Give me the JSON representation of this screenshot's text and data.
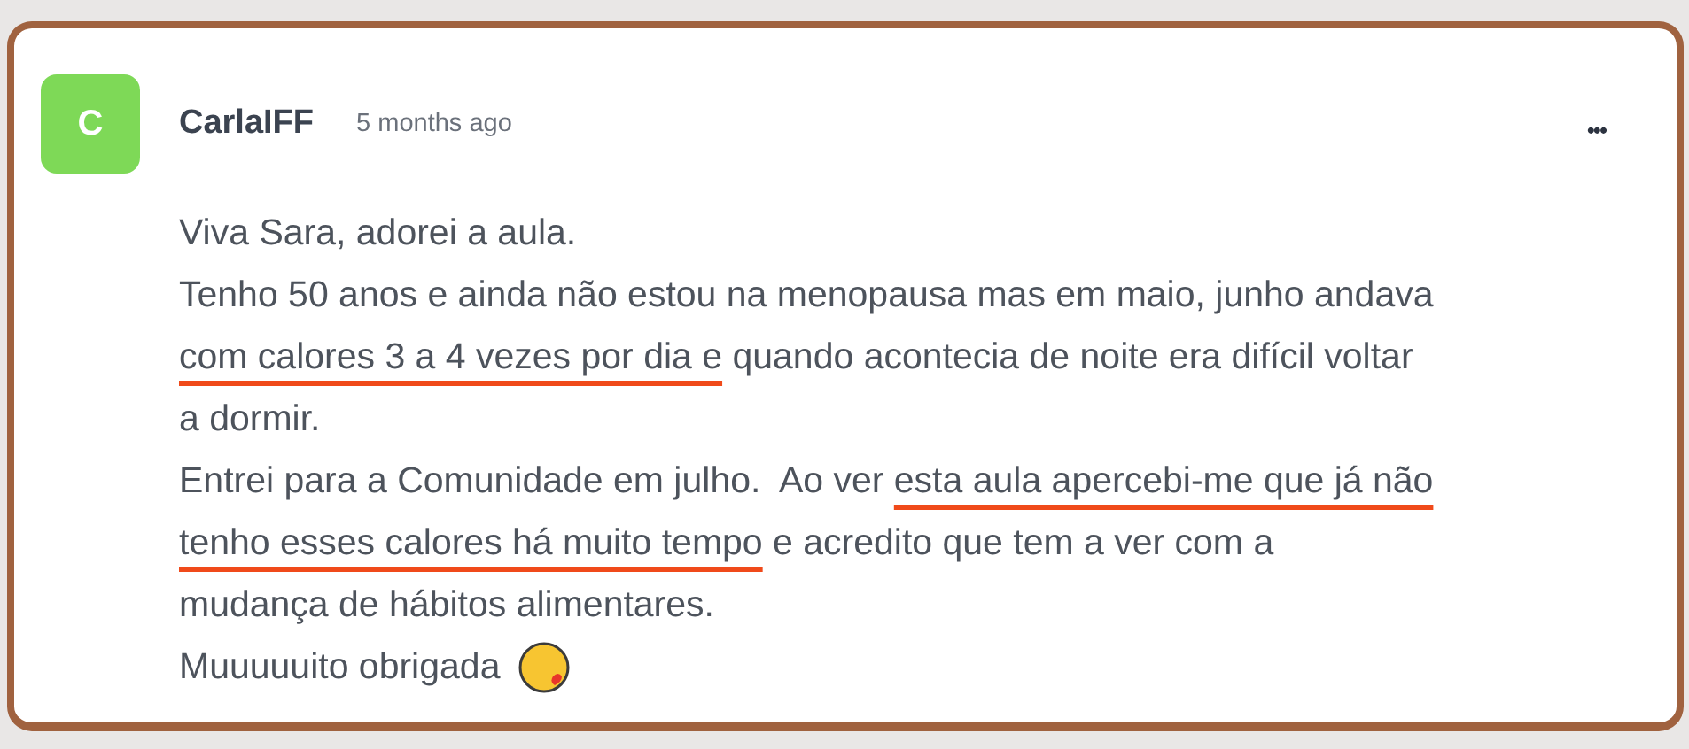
{
  "comment": {
    "avatar": "C",
    "author": "CarlaIFF",
    "time": "5 months ago",
    "menu": "•••",
    "lines": [
      [
        {
          "text": "Viva Sara, adorei a aula.",
          "underlined": false
        }
      ],
      [
        {
          "text": "Tenho 50 anos e ainda não estou na menopausa mas em maio, junho andava",
          "underlined": false
        }
      ],
      [
        {
          "text": "com calores 3 a 4 vezes por dia e",
          "underlined": true
        },
        {
          "text": " quando acontecia de noite era difícil voltar",
          "underlined": false
        }
      ],
      [
        {
          "text": "a dormir.",
          "underlined": false
        }
      ],
      [
        {
          "text": "Entrei para a Comunidade em julho.  Ao ver ",
          "underlined": false
        },
        {
          "text": "esta aula apercebi-me que já não",
          "underlined": true
        }
      ],
      [
        {
          "text": "tenho esses calores há muito tempo",
          "underlined": true
        },
        {
          "text": " e acredito que tem a ver com a",
          "underlined": false
        }
      ],
      [
        {
          "text": "mudança de hábitos alimentares.",
          "underlined": false
        }
      ],
      [
        {
          "kind": "text",
          "text": "Muuuuuito obrigada",
          "underlined": false
        },
        {
          "kind": "emoji"
        }
      ]
    ]
  }
}
